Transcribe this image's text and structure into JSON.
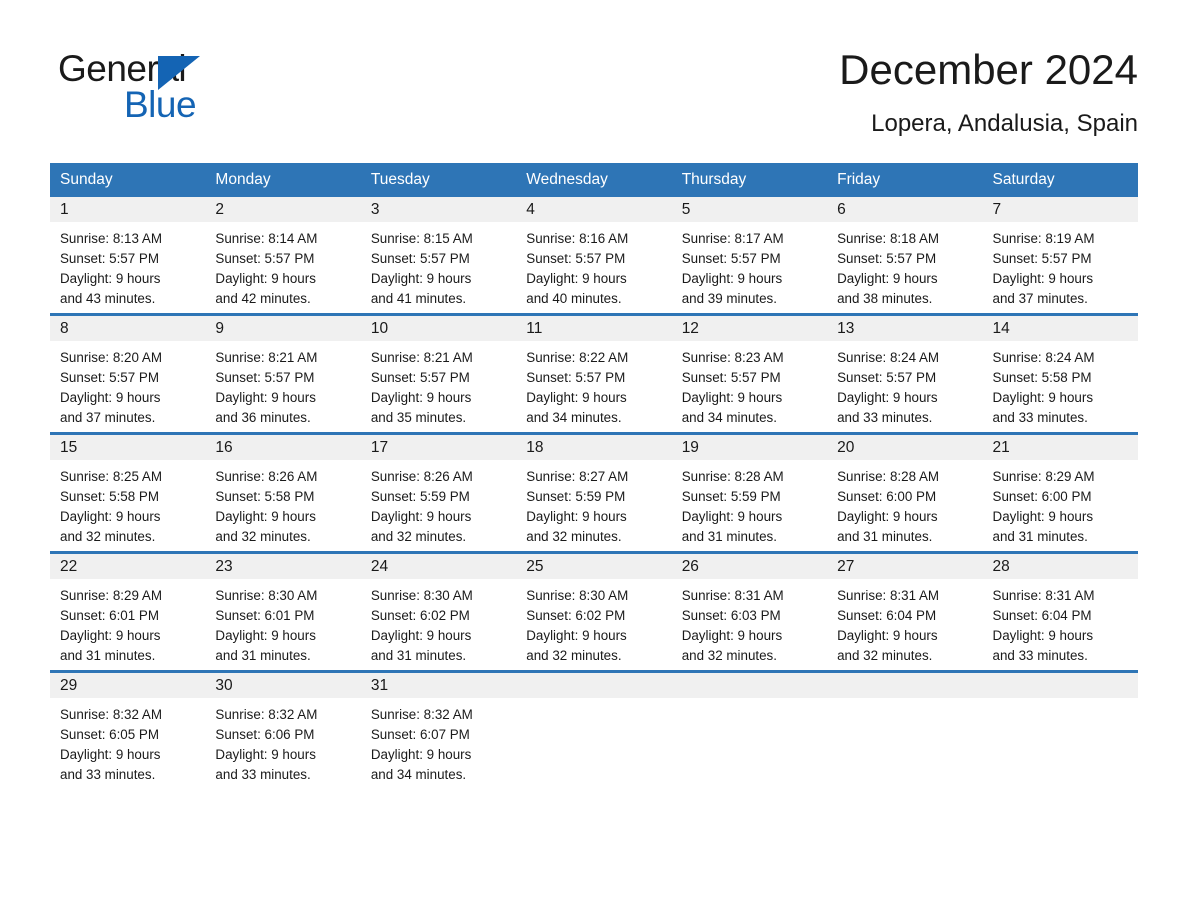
{
  "brand": {
    "name_part1": "General",
    "name_part2": "Blue",
    "accent_color": "#1464b4"
  },
  "header": {
    "title": "December 2024",
    "subtitle": "Lopera, Andalusia, Spain",
    "header_bg_color": "#2e75b6",
    "daynum_bg_color": "#f0f0f0"
  },
  "weekday_headers": [
    "Sunday",
    "Monday",
    "Tuesday",
    "Wednesday",
    "Thursday",
    "Friday",
    "Saturday"
  ],
  "weeks": [
    {
      "days": [
        {
          "num": "1",
          "sunrise": "Sunrise: 8:13 AM",
          "sunset": "Sunset: 5:57 PM",
          "daylight_line1": "Daylight: 9 hours",
          "daylight_line2": "and 43 minutes."
        },
        {
          "num": "2",
          "sunrise": "Sunrise: 8:14 AM",
          "sunset": "Sunset: 5:57 PM",
          "daylight_line1": "Daylight: 9 hours",
          "daylight_line2": "and 42 minutes."
        },
        {
          "num": "3",
          "sunrise": "Sunrise: 8:15 AM",
          "sunset": "Sunset: 5:57 PM",
          "daylight_line1": "Daylight: 9 hours",
          "daylight_line2": "and 41 minutes."
        },
        {
          "num": "4",
          "sunrise": "Sunrise: 8:16 AM",
          "sunset": "Sunset: 5:57 PM",
          "daylight_line1": "Daylight: 9 hours",
          "daylight_line2": "and 40 minutes."
        },
        {
          "num": "5",
          "sunrise": "Sunrise: 8:17 AM",
          "sunset": "Sunset: 5:57 PM",
          "daylight_line1": "Daylight: 9 hours",
          "daylight_line2": "and 39 minutes."
        },
        {
          "num": "6",
          "sunrise": "Sunrise: 8:18 AM",
          "sunset": "Sunset: 5:57 PM",
          "daylight_line1": "Daylight: 9 hours",
          "daylight_line2": "and 38 minutes."
        },
        {
          "num": "7",
          "sunrise": "Sunrise: 8:19 AM",
          "sunset": "Sunset: 5:57 PM",
          "daylight_line1": "Daylight: 9 hours",
          "daylight_line2": "and 37 minutes."
        }
      ]
    },
    {
      "days": [
        {
          "num": "8",
          "sunrise": "Sunrise: 8:20 AM",
          "sunset": "Sunset: 5:57 PM",
          "daylight_line1": "Daylight: 9 hours",
          "daylight_line2": "and 37 minutes."
        },
        {
          "num": "9",
          "sunrise": "Sunrise: 8:21 AM",
          "sunset": "Sunset: 5:57 PM",
          "daylight_line1": "Daylight: 9 hours",
          "daylight_line2": "and 36 minutes."
        },
        {
          "num": "10",
          "sunrise": "Sunrise: 8:21 AM",
          "sunset": "Sunset: 5:57 PM",
          "daylight_line1": "Daylight: 9 hours",
          "daylight_line2": "and 35 minutes."
        },
        {
          "num": "11",
          "sunrise": "Sunrise: 8:22 AM",
          "sunset": "Sunset: 5:57 PM",
          "daylight_line1": "Daylight: 9 hours",
          "daylight_line2": "and 34 minutes."
        },
        {
          "num": "12",
          "sunrise": "Sunrise: 8:23 AM",
          "sunset": "Sunset: 5:57 PM",
          "daylight_line1": "Daylight: 9 hours",
          "daylight_line2": "and 34 minutes."
        },
        {
          "num": "13",
          "sunrise": "Sunrise: 8:24 AM",
          "sunset": "Sunset: 5:57 PM",
          "daylight_line1": "Daylight: 9 hours",
          "daylight_line2": "and 33 minutes."
        },
        {
          "num": "14",
          "sunrise": "Sunrise: 8:24 AM",
          "sunset": "Sunset: 5:58 PM",
          "daylight_line1": "Daylight: 9 hours",
          "daylight_line2": "and 33 minutes."
        }
      ]
    },
    {
      "days": [
        {
          "num": "15",
          "sunrise": "Sunrise: 8:25 AM",
          "sunset": "Sunset: 5:58 PM",
          "daylight_line1": "Daylight: 9 hours",
          "daylight_line2": "and 32 minutes."
        },
        {
          "num": "16",
          "sunrise": "Sunrise: 8:26 AM",
          "sunset": "Sunset: 5:58 PM",
          "daylight_line1": "Daylight: 9 hours",
          "daylight_line2": "and 32 minutes."
        },
        {
          "num": "17",
          "sunrise": "Sunrise: 8:26 AM",
          "sunset": "Sunset: 5:59 PM",
          "daylight_line1": "Daylight: 9 hours",
          "daylight_line2": "and 32 minutes."
        },
        {
          "num": "18",
          "sunrise": "Sunrise: 8:27 AM",
          "sunset": "Sunset: 5:59 PM",
          "daylight_line1": "Daylight: 9 hours",
          "daylight_line2": "and 32 minutes."
        },
        {
          "num": "19",
          "sunrise": "Sunrise: 8:28 AM",
          "sunset": "Sunset: 5:59 PM",
          "daylight_line1": "Daylight: 9 hours",
          "daylight_line2": "and 31 minutes."
        },
        {
          "num": "20",
          "sunrise": "Sunrise: 8:28 AM",
          "sunset": "Sunset: 6:00 PM",
          "daylight_line1": "Daylight: 9 hours",
          "daylight_line2": "and 31 minutes."
        },
        {
          "num": "21",
          "sunrise": "Sunrise: 8:29 AM",
          "sunset": "Sunset: 6:00 PM",
          "daylight_line1": "Daylight: 9 hours",
          "daylight_line2": "and 31 minutes."
        }
      ]
    },
    {
      "days": [
        {
          "num": "22",
          "sunrise": "Sunrise: 8:29 AM",
          "sunset": "Sunset: 6:01 PM",
          "daylight_line1": "Daylight: 9 hours",
          "daylight_line2": "and 31 minutes."
        },
        {
          "num": "23",
          "sunrise": "Sunrise: 8:30 AM",
          "sunset": "Sunset: 6:01 PM",
          "daylight_line1": "Daylight: 9 hours",
          "daylight_line2": "and 31 minutes."
        },
        {
          "num": "24",
          "sunrise": "Sunrise: 8:30 AM",
          "sunset": "Sunset: 6:02 PM",
          "daylight_line1": "Daylight: 9 hours",
          "daylight_line2": "and 31 minutes."
        },
        {
          "num": "25",
          "sunrise": "Sunrise: 8:30 AM",
          "sunset": "Sunset: 6:02 PM",
          "daylight_line1": "Daylight: 9 hours",
          "daylight_line2": "and 32 minutes."
        },
        {
          "num": "26",
          "sunrise": "Sunrise: 8:31 AM",
          "sunset": "Sunset: 6:03 PM",
          "daylight_line1": "Daylight: 9 hours",
          "daylight_line2": "and 32 minutes."
        },
        {
          "num": "27",
          "sunrise": "Sunrise: 8:31 AM",
          "sunset": "Sunset: 6:04 PM",
          "daylight_line1": "Daylight: 9 hours",
          "daylight_line2": "and 32 minutes."
        },
        {
          "num": "28",
          "sunrise": "Sunrise: 8:31 AM",
          "sunset": "Sunset: 6:04 PM",
          "daylight_line1": "Daylight: 9 hours",
          "daylight_line2": "and 33 minutes."
        }
      ]
    },
    {
      "days": [
        {
          "num": "29",
          "sunrise": "Sunrise: 8:32 AM",
          "sunset": "Sunset: 6:05 PM",
          "daylight_line1": "Daylight: 9 hours",
          "daylight_line2": "and 33 minutes."
        },
        {
          "num": "30",
          "sunrise": "Sunrise: 8:32 AM",
          "sunset": "Sunset: 6:06 PM",
          "daylight_line1": "Daylight: 9 hours",
          "daylight_line2": "and 33 minutes."
        },
        {
          "num": "31",
          "sunrise": "Sunrise: 8:32 AM",
          "sunset": "Sunset: 6:07 PM",
          "daylight_line1": "Daylight: 9 hours",
          "daylight_line2": "and 34 minutes."
        },
        {
          "num": "",
          "sunrise": "",
          "sunset": "",
          "daylight_line1": "",
          "daylight_line2": "",
          "empty": true
        },
        {
          "num": "",
          "sunrise": "",
          "sunset": "",
          "daylight_line1": "",
          "daylight_line2": "",
          "empty": true
        },
        {
          "num": "",
          "sunrise": "",
          "sunset": "",
          "daylight_line1": "",
          "daylight_line2": "",
          "empty": true
        },
        {
          "num": "",
          "sunrise": "",
          "sunset": "",
          "daylight_line1": "",
          "daylight_line2": "",
          "empty": true
        }
      ]
    }
  ]
}
